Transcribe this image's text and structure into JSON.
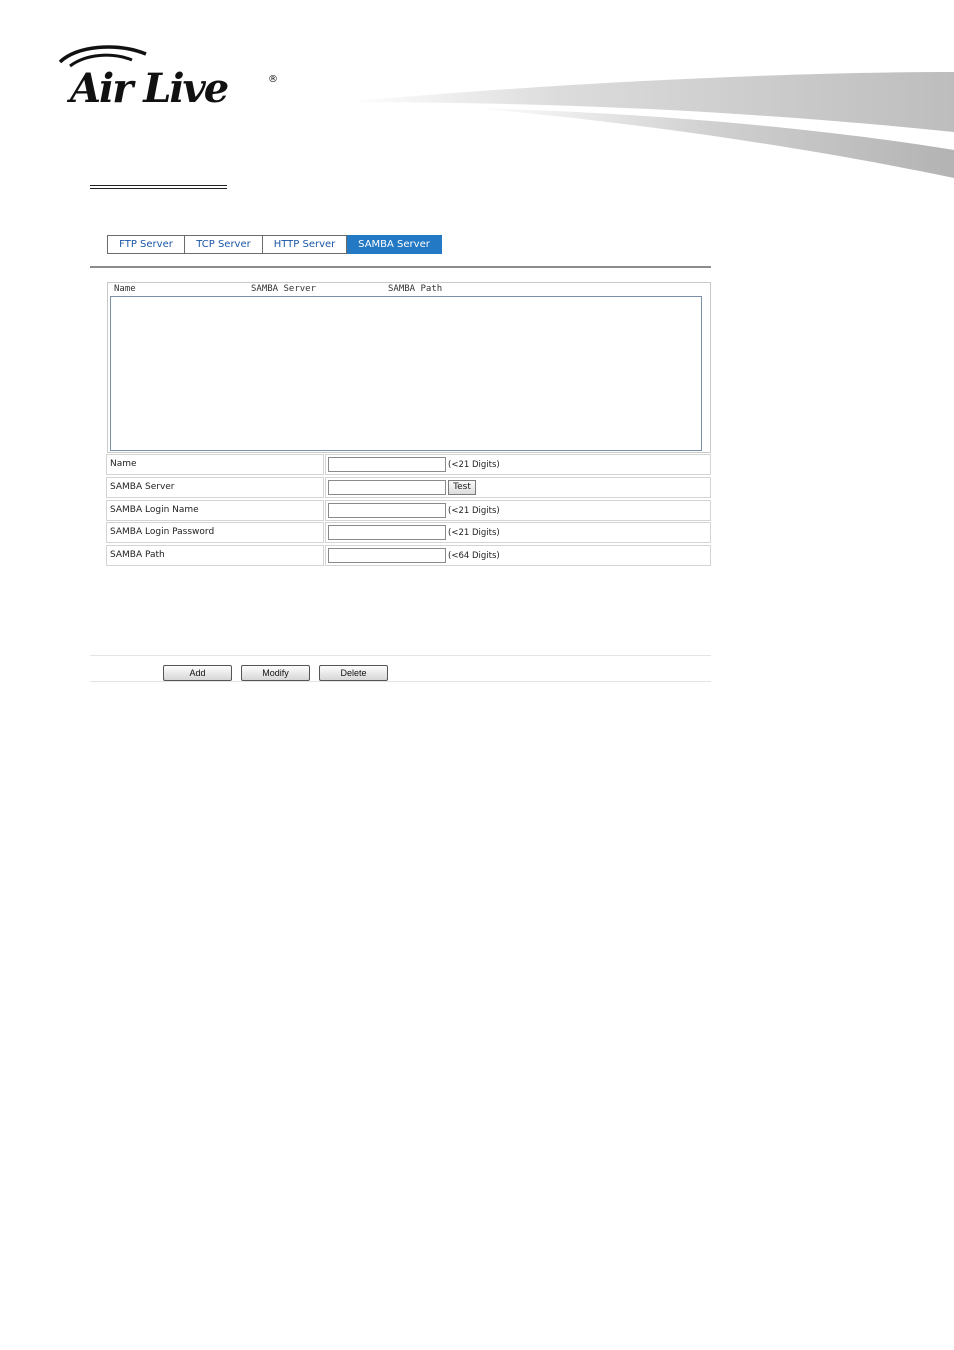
{
  "brand": {
    "logo_text": "Air Live",
    "accent": "#2379c4",
    "link_color": "#1a56a8"
  },
  "tabs": [
    {
      "label": "FTP Server",
      "active": false
    },
    {
      "label": "TCP Server",
      "active": false
    },
    {
      "label": "HTTP Server",
      "active": false
    },
    {
      "label": "SAMBA Server",
      "active": true
    }
  ],
  "list": {
    "columns": [
      "Name",
      "SAMBA Server",
      "SAMBA Path"
    ],
    "rows": []
  },
  "form": {
    "name": {
      "label": "Name",
      "value": "",
      "hint": "(<21 Digits)"
    },
    "server": {
      "label": "SAMBA Server",
      "value": "",
      "test_label": "Test"
    },
    "login_name": {
      "label": "SAMBA Login Name",
      "value": "",
      "hint": "(<21 Digits)"
    },
    "login_password": {
      "label": "SAMBA Login Password",
      "value": "",
      "hint": "(<21 Digits)"
    },
    "path": {
      "label": "SAMBA Path",
      "value": "",
      "hint": "(<64 Digits)"
    }
  },
  "actions": {
    "add": "Add",
    "modify": "Modify",
    "delete": "Delete"
  }
}
